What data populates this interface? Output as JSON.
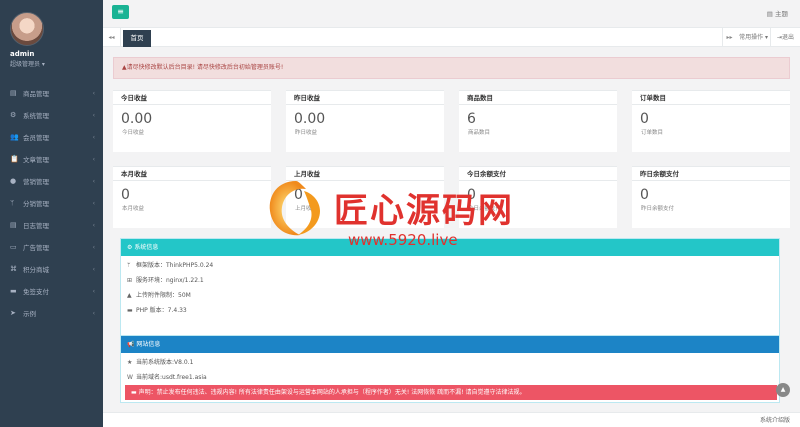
{
  "sidebar": {
    "username": "admin",
    "role": "超级管理员",
    "items": [
      {
        "icon": "▤",
        "label": "商品管理"
      },
      {
        "icon": "⚙",
        "label": "系统管理"
      },
      {
        "icon": "👥",
        "label": "会员管理"
      },
      {
        "icon": "📋",
        "label": "文章管理"
      },
      {
        "icon": "●",
        "label": "营销管理"
      },
      {
        "icon": "ᛘ",
        "label": "分销管理"
      },
      {
        "icon": "▤",
        "label": "日志管理"
      },
      {
        "icon": "▭",
        "label": "广告管理"
      },
      {
        "icon": "⌘",
        "label": "积分商城"
      },
      {
        "icon": "▬",
        "label": "免签支付"
      },
      {
        "icon": "➤",
        "label": "示例"
      }
    ]
  },
  "topbar": {
    "menu_icon": "≡",
    "theme_label": "主题"
  },
  "tabs": {
    "prev": "◂◂",
    "active": "首页",
    "next": "▸▸",
    "ops": "常用操作 ▾",
    "close": "⇥退出"
  },
  "alert": {
    "text": "▲请尽快修改默认后台目录! 请尽快修改后台初始管理员账号!"
  },
  "stats": [
    {
      "title": "今日收益",
      "value": "0.00",
      "sub": "今日收益"
    },
    {
      "title": "昨日收益",
      "value": "0.00",
      "sub": "昨日收益"
    },
    {
      "title": "商品数目",
      "value": "6",
      "sub": "商品数目"
    },
    {
      "title": "订单数目",
      "value": "0",
      "sub": "订单数目"
    },
    {
      "title": "本月收益",
      "value": "0",
      "sub": "本月收益"
    },
    {
      "title": "上月收益",
      "value": "0",
      "sub": "上月收益"
    },
    {
      "title": "今日余额支付",
      "value": "0",
      "sub": "今日余额支付"
    },
    {
      "title": "昨日余额支付",
      "value": "0",
      "sub": "昨日余额支付"
    }
  ],
  "system_panel": {
    "title": "系统信息",
    "rows": [
      {
        "icon": "ᛘ",
        "text": "框架版本：ThinkPHP5.0.24"
      },
      {
        "icon": "⊞",
        "text": "服务环境：nginx/1.22.1"
      },
      {
        "icon": "▲",
        "text": "上传附件限制：50M"
      },
      {
        "icon": "▬",
        "text": "PHP 版本：7.4.33"
      }
    ]
  },
  "site_panel": {
    "title": "网站信息",
    "rows": [
      {
        "icon": "★",
        "text": "当前系统版本:V8.0.1"
      },
      {
        "icon": "W",
        "text": "当前域名:usdt.free1.asia"
      }
    ],
    "notice": "声明：禁止发布任何违法、违规内容! 所有法律责任由架设与运营本网站的人承担与（程序作者）无关! 法网恢恢 疏而不漏! 请自觉遵守法律法规。"
  },
  "footer": {
    "text": "系统介绍版"
  },
  "watermark": {
    "title": "匠心源码网",
    "url": "www.5920.live"
  }
}
